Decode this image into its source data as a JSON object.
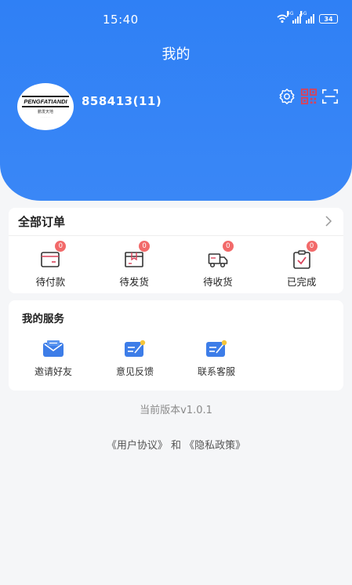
{
  "status_bar": {
    "time": "15:40",
    "network_1": "4G",
    "network_2": "5G",
    "battery": "34"
  },
  "header": {
    "title": "我的",
    "username": "858413(11)",
    "avatar_logo_text": "PENGFATIANDI",
    "avatar_logo_sub": "鹏发天地",
    "icons": [
      "settings-icon",
      "qr-code-icon",
      "scan-icon"
    ]
  },
  "orders": {
    "title": "全部订单",
    "items": [
      {
        "label": "待付款",
        "count": "0",
        "icon": "wallet-icon"
      },
      {
        "label": "待发货",
        "count": "0",
        "icon": "package-icon"
      },
      {
        "label": "待收货",
        "count": "0",
        "icon": "truck-icon"
      },
      {
        "label": "已完成",
        "count": "0",
        "icon": "clipboard-check-icon"
      }
    ]
  },
  "services": {
    "title": "我的服务",
    "items": [
      {
        "label": "邀请好友",
        "icon": "invite-mail-icon"
      },
      {
        "label": "意见反馈",
        "icon": "feedback-icon"
      },
      {
        "label": "联系客服",
        "icon": "customer-service-icon"
      }
    ]
  },
  "footer": {
    "version": "当前版本v1.0.1",
    "user_agreement": "《用户协议》",
    "and": " 和 ",
    "privacy_policy": "《隐私政策》"
  },
  "colors": {
    "primary": "#2f80f5",
    "badge": "#f26a6a",
    "icon_red": "#d9425a",
    "service_icon_blue": "#3d7de8",
    "service_icon_accent": "#f5c53a"
  }
}
